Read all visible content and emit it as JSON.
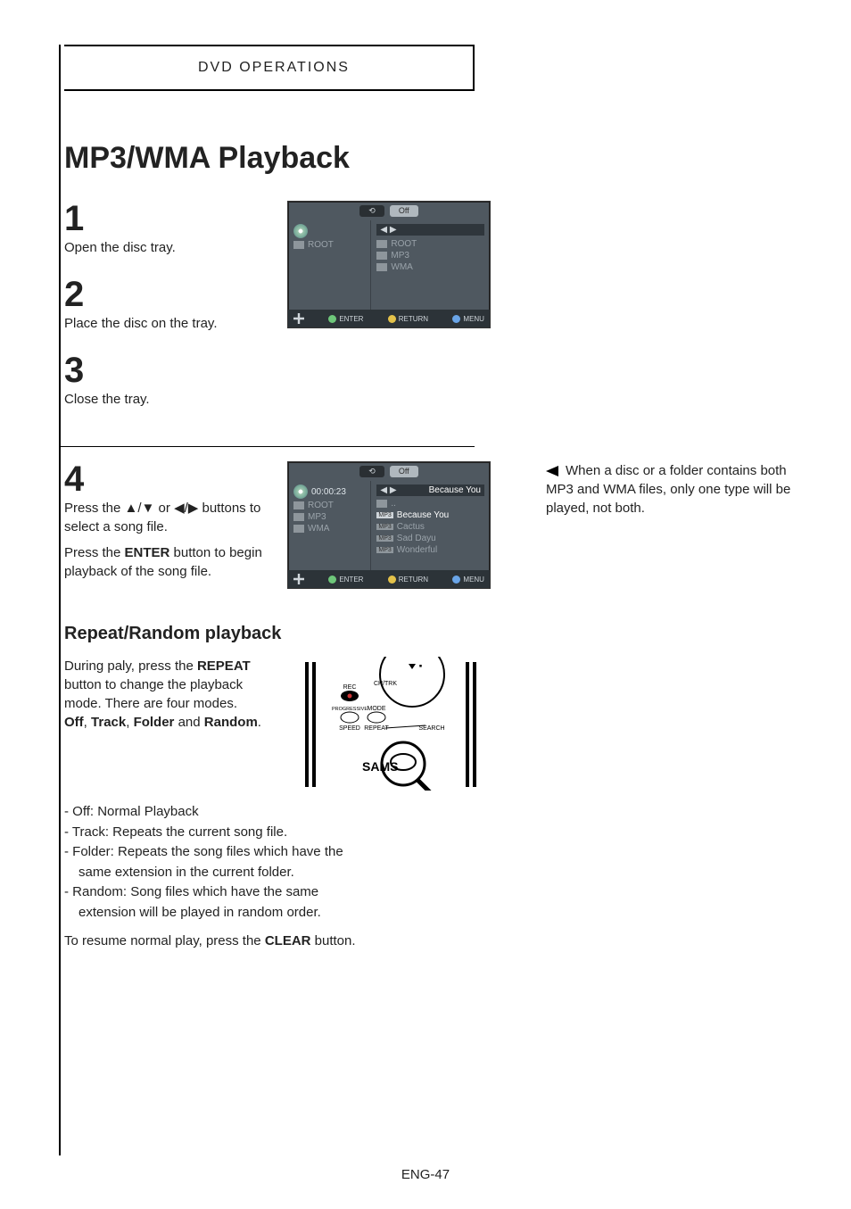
{
  "header": {
    "label": "DVD OPERATIONS"
  },
  "title": "MP3/WMA Playback",
  "steps": {
    "s1": {
      "num": "1",
      "text": "Open the disc tray."
    },
    "s2": {
      "num": "2",
      "text": "Place the disc on the tray."
    },
    "s3": {
      "num": "3",
      "text": "Close the tray."
    },
    "s4": {
      "num": "4",
      "text1_a": "Press the ",
      "text1_arrows": "▲/▼ or ◀/▶",
      "text1_b": " buttons to select a song file.",
      "text2_a": "Press the ",
      "text2_bold": "ENTER",
      "text2_b": " button to begin playback of the song file."
    }
  },
  "osd1": {
    "mode": "Off",
    "left_root": "ROOT",
    "right_root": "ROOT",
    "mp3": "MP3",
    "wma": "WMA",
    "btn_enter": "ENTER",
    "btn_return": "RETURN",
    "btn_menu": "MENU"
  },
  "osd2": {
    "mode": "Off",
    "time": "00:00:23",
    "now": "Because You",
    "left_root": "ROOT",
    "left_mp3": "MP3",
    "left_wma": "WMA",
    "tracks": [
      "..",
      "Because You",
      "Cactus",
      "Sad Dayu",
      "Wonderful"
    ],
    "btn_enter": "ENTER",
    "btn_return": "RETURN",
    "btn_menu": "MENU"
  },
  "note": "When a disc or a folder contains both MP3 and WMA files, only one type will be played, not both.",
  "repeat_section": {
    "heading": "Repeat/Random playback",
    "para_a": "During paly, press the ",
    "para_bold1": "REPEAT",
    "para_b": " button to change the playback mode. There are four modes.",
    "modes_label_off": "Off",
    "modes_sep1": ", ",
    "modes_label_track": "Track",
    "modes_sep2": ", ",
    "modes_label_folder": "Folder",
    "modes_and": " and ",
    "modes_label_random": "Random",
    "modes_period": "."
  },
  "remote": {
    "labels": {
      "rec": "REC",
      "chtrk": "CH/TRK",
      "progressive": "PROGRESSIVE",
      "mode": "MODE",
      "speed": "SPEED",
      "repeat": "REPEAT",
      "search": "SEARCH",
      "brand": "SAMS"
    }
  },
  "mode_desc": {
    "off": "- Off: Normal Playback",
    "track": "- Track: Repeats the current song file.",
    "folder1": "- Folder: Repeats the song files which have the",
    "folder2": "same extension in the current folder.",
    "random1": "- Random: Song files which have the same",
    "random2": "extension will be played in random order.",
    "resume_a": "To resume normal play, press the ",
    "resume_bold": "CLEAR",
    "resume_b": " button."
  },
  "page_num": "ENG-47"
}
